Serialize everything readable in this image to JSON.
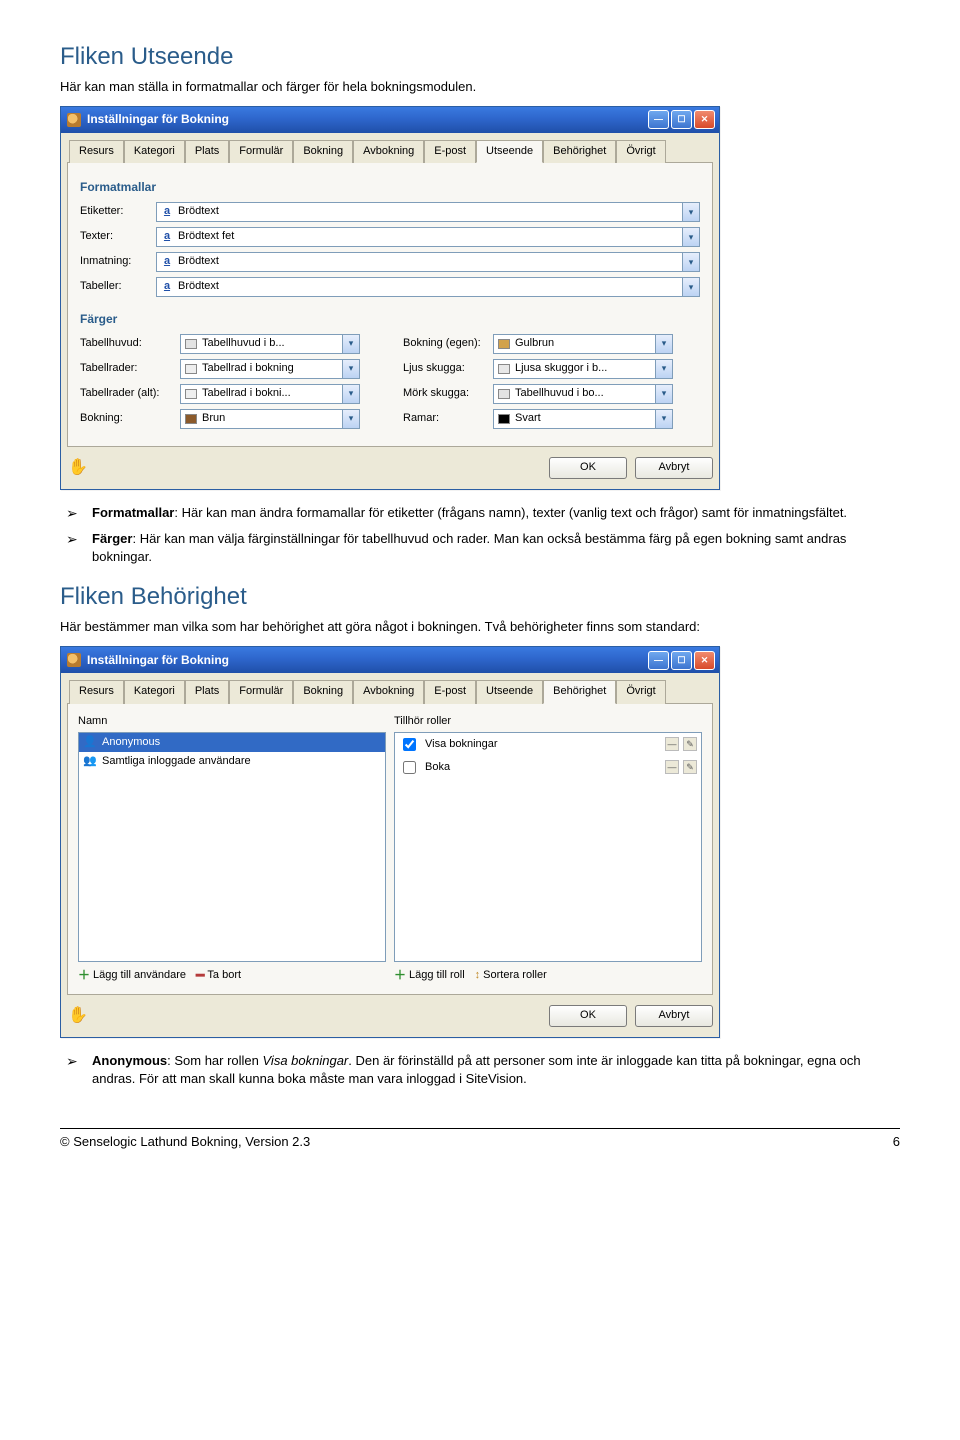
{
  "sections": {
    "utseende": {
      "heading": "Fliken Utseende",
      "intro": "Här kan man ställa in formatmallar och färger för hela bokningsmodulen."
    },
    "behorighet": {
      "heading": "Fliken Behörighet",
      "intro": "Här bestämmer man vilka som har behörighet att göra något i bokningen. Två behörigheter finns som standard:"
    }
  },
  "window": {
    "title": "Inställningar för Bokning",
    "tabs": [
      "Resurs",
      "Kategori",
      "Plats",
      "Formulär",
      "Bokning",
      "Avbokning",
      "E-post",
      "Utseende",
      "Behörighet",
      "Övrigt"
    ],
    "active_tab_utseende": "Utseende",
    "active_tab_behorighet": "Behörighet",
    "ok": "OK",
    "cancel": "Avbryt"
  },
  "formatmallar": {
    "heading": "Formatmallar",
    "rows": {
      "etiketter": {
        "label": "Etiketter:",
        "value": "Brödtext"
      },
      "texter": {
        "label": "Texter:",
        "value": "Brödtext fet"
      },
      "inmatning": {
        "label": "Inmatning:",
        "value": "Brödtext"
      },
      "tabeller": {
        "label": "Tabeller:",
        "value": "Brödtext"
      }
    }
  },
  "farger": {
    "heading": "Färger",
    "left": {
      "tabellhuvud": {
        "label": "Tabellhuvud:",
        "value": "Tabellhuvud i b...",
        "swatch": "#e3e3e3"
      },
      "tabellrader": {
        "label": "Tabellrader:",
        "value": "Tabellrad i bokning",
        "swatch": "#eeeeee"
      },
      "tabellrader_alt": {
        "label": "Tabellrader (alt):",
        "value": "Tabellrad i bokni...",
        "swatch": "#eeeeee"
      },
      "bokning": {
        "label": "Bokning:",
        "value": "Brun",
        "swatch": "#8b5a2b"
      }
    },
    "right": {
      "bokning_egen": {
        "label": "Bokning (egen):",
        "value": "Gulbrun",
        "swatch": "#d2a24c"
      },
      "ljus_skugga": {
        "label": "Ljus skugga:",
        "value": "Ljusa skuggor i b...",
        "swatch": "#e8e8e8"
      },
      "mork_skugga": {
        "label": "Mörk skugga:",
        "value": "Tabellhuvud i bo...",
        "swatch": "#e3e3e3"
      },
      "ramar": {
        "label": "Ramar:",
        "value": "Svart",
        "swatch": "#000000"
      }
    }
  },
  "bullets_utseende": {
    "formatmallar": {
      "term": "Formatmallar",
      "text": ": Här kan man ändra formamallar för etiketter (frågans namn), texter (vanlig text och frågor) samt för inmatningsfältet."
    },
    "farger": {
      "term": "Färger",
      "text": ": Här kan man välja färginställningar för tabellhuvud och rader. Man kan också bestämma färg på egen bokning samt andras bokningar."
    }
  },
  "behorighet_panel": {
    "left_header": "Namn",
    "right_header": "Tillhör roller",
    "users": [
      {
        "name": "Anonymous",
        "icon": "user"
      },
      {
        "name": "Samtliga inloggade användare",
        "icon": "group"
      }
    ],
    "roles": [
      {
        "label": "Visa bokningar",
        "checked": true
      },
      {
        "label": "Boka",
        "checked": false
      }
    ],
    "footer_left": {
      "add": "Lägg till användare",
      "remove": "Ta bort"
    },
    "footer_right": {
      "add": "Lägg till roll",
      "sort": "Sortera roller"
    }
  },
  "bullets_behorighet": {
    "anonymous": {
      "term": "Anonymous",
      "mid": ": Som har rollen ",
      "role": "Visa bokningar",
      "text": ". Den är förinställd på att personer som inte är inloggade kan titta på bokningar, egna och andras. För att man skall kunna boka måste man vara inloggad i SiteVision."
    }
  },
  "footer": {
    "left": "© Senselogic Lathund Bokning, Version 2.3",
    "right": "6"
  }
}
